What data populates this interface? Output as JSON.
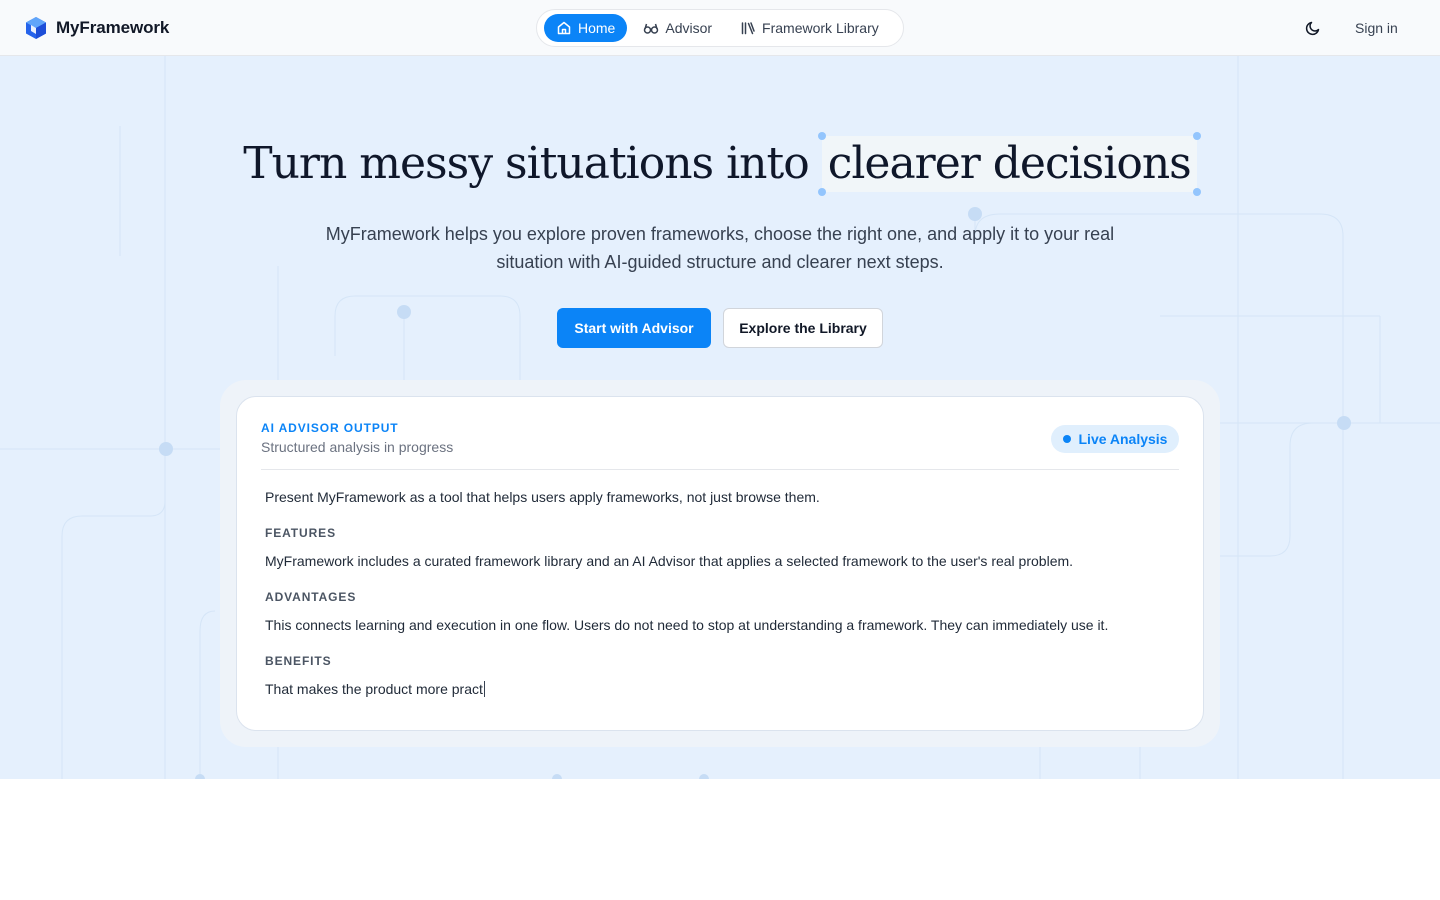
{
  "header": {
    "brand": "MyFramework",
    "nav": [
      {
        "label": "Home",
        "icon": "home-icon",
        "active": true
      },
      {
        "label": "Advisor",
        "icon": "glasses-icon",
        "active": false
      },
      {
        "label": "Framework Library",
        "icon": "library-icon",
        "active": false
      }
    ],
    "theme_icon": "moon-icon",
    "signin_label": "Sign in"
  },
  "hero": {
    "headline_prefix": "Turn messy situations into",
    "headline_highlight": "clearer decisions",
    "subtitle": "MyFramework helps you explore proven frameworks, choose the right one, and apply it to your real situation with AI-guided structure and clearer next steps.",
    "primary_button": "Start with Advisor",
    "secondary_button": "Explore the Library"
  },
  "advisor_card": {
    "eyebrow": "AI ADVISOR OUTPUT",
    "subtitle": "Structured analysis in progress",
    "badge": "Live Analysis",
    "intro": "Present MyFramework as a tool that helps users apply frameworks, not just browse them.",
    "sections": [
      {
        "label": "FEATURES",
        "text": "MyFramework includes a curated framework library and an AI Advisor that applies a selected framework to the user's real problem."
      },
      {
        "label": "ADVANTAGES",
        "text": "This connects learning and execution in one flow. Users do not need to stop at understanding a framework. They can immediately use it."
      },
      {
        "label": "BENEFITS",
        "text": "That makes the product more pract"
      }
    ]
  },
  "colors": {
    "accent": "#0b84f7",
    "hero_background": "#e5f0fd",
    "text": "#111827"
  }
}
